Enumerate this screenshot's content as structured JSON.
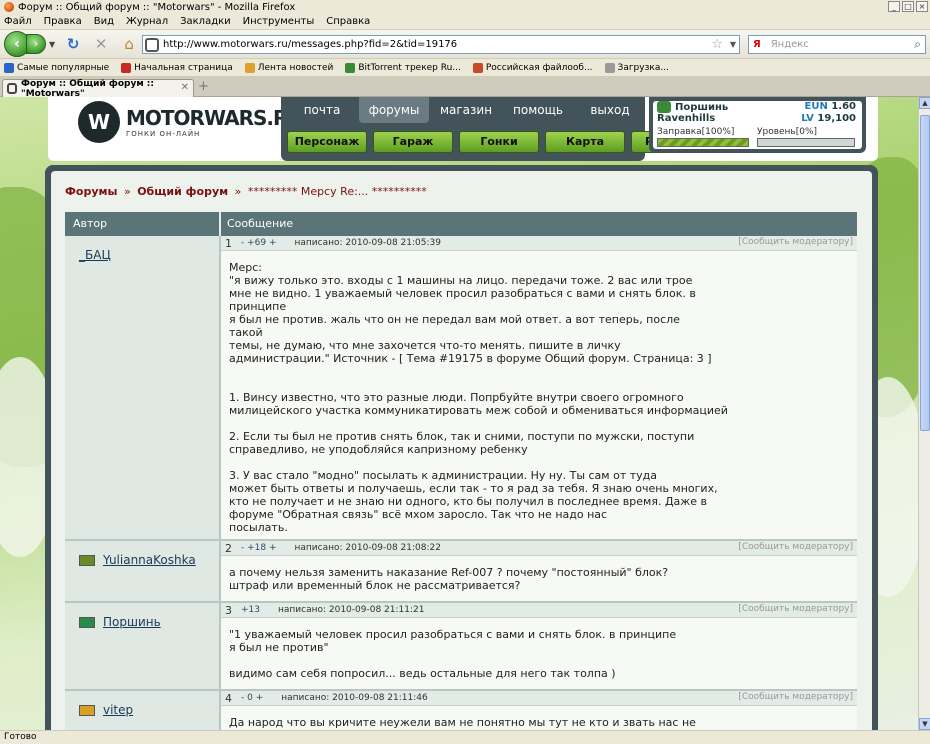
{
  "window": {
    "title": "Форум :: Общий форум :: \"Motorwars\" - Mozilla Firefox"
  },
  "menu": [
    "Файл",
    "Правка",
    "Вид",
    "Журнал",
    "Закладки",
    "Инструменты",
    "Справка"
  ],
  "nav": {
    "url": "http://www.motorwars.ru/messages.php?fid=2&tid=19176",
    "search_placeholder": "Яндекс",
    "search_engine_label": "Я"
  },
  "bookmarks": [
    {
      "label": "Самые популярные",
      "color": "#2a64c8"
    },
    {
      "label": "Начальная страница",
      "color": "#c82a2a"
    },
    {
      "label": "Лента новостей",
      "color": "#e0a030"
    },
    {
      "label": "BitTorrent трекер Ru...",
      "color": "#3a8a3a"
    },
    {
      "label": "Российская файлооб...",
      "color": "#c84a2a"
    },
    {
      "label": "Загрузка...",
      "color": "#9a9a9a"
    }
  ],
  "tab": {
    "title": "Форум :: Общий форум :: \"Motorwars\""
  },
  "site": {
    "logo_title": "MOTORWARS.RU",
    "logo_subtitle": "ГОНКИ ОН-ЛАЙН",
    "logo_mark": "W",
    "nav_top": [
      "почта",
      "форумы",
      "магазин",
      "помощь",
      "выход"
    ],
    "nav_active": "форумы",
    "nav_buttons": [
      "Персонаж",
      "Гараж",
      "Гонки",
      "Карта",
      "Рулетка"
    ]
  },
  "player": {
    "name": "Поршинь",
    "city": "Ravenhills",
    "eun_label": "EUN",
    "eun_value": "1.60",
    "lv_label": "LV",
    "lv_value": "19,100",
    "fuel_label": "Заправка[100%]",
    "fuel_percent": 100,
    "level_label": "Уровень[0%]",
    "level_percent": 0
  },
  "breadcrumb": {
    "forums": "Форумы",
    "sep": "»",
    "forum": "Общий форум",
    "topic": "********* Мерсу Re:... **********"
  },
  "table": {
    "col_author": "Автор",
    "col_message": "Сообщение",
    "report_label": "[Сообщить модератору]"
  },
  "posts": [
    {
      "num": "1",
      "rating": "- +69 +",
      "date": "написано: 2010-09-08 21:05:39",
      "author": "_БАЦ",
      "author_icon_color": "",
      "text_lines": [
        "Мерс:",
        "\"я вижу только это. входы с 1 машины на лицо. передачи тоже. 2 вас или трое",
        "мне не видно. 1 уважаемый человек просил разобраться с вами и снять блок. в",
        "принципе",
        "я был не против. жаль что он не передал вам мой ответ. а вот теперь, после",
        "такой",
        "темы, не думаю, что мне захочется что-то менять. пишите в личку",
        "администрации.\" Источник - [ Тема #19175 в форуме Общий форум. Страница: 3 ]",
        "",
        "",
        "1. Винсу известно, что это разные люди. Попрбуйте внутри своего огромного",
        "милицейского участка коммуникатировать меж собой и обмениваться информацией",
        "",
        "2. Если ты был не против снять блок, так и сними, поступи по мужски, поступи",
        "справедливо, не уподобляйся капризному ребенку",
        "",
        "3. У вас стало \"модно\" посылать к администрации. Ну ну. Ты сам от туда",
        "может быть ответы и получаешь, если так - то я рад за тебя. Я знаю очень многих,",
        "кто не получает и не знаю ни одного, кто бы получил в последнее время. Даже в",
        "форуме \"Обратная связь\" всё мхом заросло. Так что не надо нас",
        "посылать."
      ]
    },
    {
      "num": "2",
      "rating": "- +18 +",
      "date": "написано: 2010-09-08 21:08:22",
      "author": "YuliannaKoshka",
      "author_icon_color": "#6a8a2a",
      "text_lines": [
        "а почему нельзя заменить наказание Ref-007 ? почему \"постоянный\" блок?",
        "штраф или временный блок не рассматривается?"
      ]
    },
    {
      "num": "3",
      "rating": "+13",
      "date": "написано: 2010-09-08 21:11:21",
      "author": "Поршинь",
      "author_icon_color": "#2a8a4a",
      "text_lines": [
        "\"1 уважаемый человек просил разобраться с вами и снять блок. в принципе",
        "я был не против\"",
        "",
        "видимо сам себя попросил... ведь остальные для него так толпа )"
      ]
    },
    {
      "num": "4",
      "rating": "- 0 +",
      "date": "написано: 2010-09-08 21:11:46",
      "author": "vitep",
      "author_icon_color": "#d8a020",
      "text_lines": [
        "Да народ что вы кричите неужели вам не понятно мы тут не кто и звать нас не"
      ]
    }
  ],
  "statusbar": "Готово"
}
